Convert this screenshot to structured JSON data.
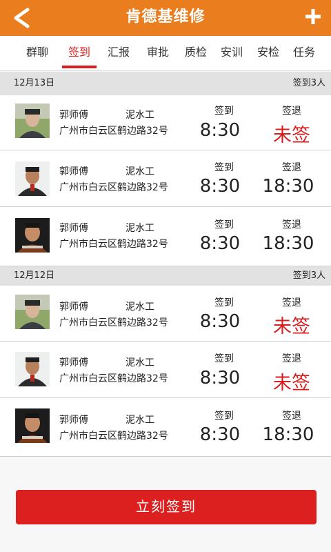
{
  "header": {
    "title": "肯德基维修"
  },
  "tabs": [
    {
      "label": "群聊"
    },
    {
      "label": "签到"
    },
    {
      "label": "汇报"
    },
    {
      "label": "审批"
    },
    {
      "label": "质检"
    },
    {
      "label": "安训"
    },
    {
      "label": "安检"
    },
    {
      "label": "任务"
    }
  ],
  "active_tab": "签到",
  "groups": [
    {
      "date": "12月13日",
      "count": "签到3人",
      "rows": [
        {
          "name": "郭师傅",
          "role": "泥水工",
          "address": "广州市白云区鹤边路32号",
          "in_label": "签到",
          "in_time": "8:30",
          "out_label": "签退",
          "out_time": "未签",
          "out_missing": true
        },
        {
          "name": "郭师傅",
          "role": "泥水工",
          "address": "广州市白云区鹤边路32号",
          "in_label": "签到",
          "in_time": "8:30",
          "out_label": "签退",
          "out_time": "18:30",
          "out_missing": false
        },
        {
          "name": "郭师傅",
          "role": "泥水工",
          "address": "广州市白云区鹤边路32号",
          "in_label": "签到",
          "in_time": "8:30",
          "out_label": "签退",
          "out_time": "18:30",
          "out_missing": false
        }
      ]
    },
    {
      "date": "12月12日",
      "count": "签到3人",
      "rows": [
        {
          "name": "郭师傅",
          "role": "泥水工",
          "address": "广州市白云区鹤边路32号",
          "in_label": "签到",
          "in_time": "8:30",
          "out_label": "签退",
          "out_time": "未签",
          "out_missing": true
        },
        {
          "name": "郭师傅",
          "role": "泥水工",
          "address": "广州市白云区鹤边路32号",
          "in_label": "签到",
          "in_time": "8:30",
          "out_label": "签退",
          "out_time": "未签",
          "out_missing": true
        },
        {
          "name": "郭师傅",
          "role": "泥水工",
          "address": "广州市白云区鹤边路32号",
          "in_label": "签到",
          "in_time": "8:30",
          "out_label": "签退",
          "out_time": "18:30",
          "out_missing": false
        }
      ]
    }
  ],
  "bottom_button": {
    "label": "立刻签到"
  },
  "colors": {
    "header": "#ea7d1e",
    "accent_red": "#d81e1e",
    "button": "#dc1f1f"
  },
  "icons": {
    "back": "chevron-left-icon",
    "add": "plus-icon"
  }
}
